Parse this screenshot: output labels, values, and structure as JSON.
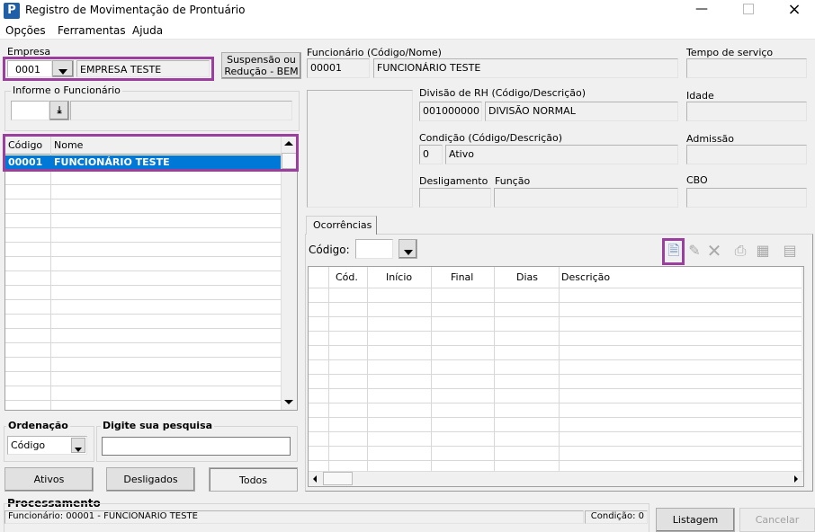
{
  "window": {
    "title": "Registro de Movimentação de Prontuário",
    "app_icon": "P"
  },
  "menu": [
    "Opções",
    "Ferramentas",
    "Ajuda"
  ],
  "empresa": {
    "label": "Empresa",
    "code": "0001",
    "name": "EMPRESA TESTE"
  },
  "suspensao_button": {
    "line1": "Suspensão ou",
    "line2": "Redução - BEM"
  },
  "informe": {
    "label": "Informe o Funcionário",
    "value": "",
    "name": ""
  },
  "employee_grid": {
    "columns": [
      "Código",
      "Nome"
    ],
    "rows": [
      {
        "codigo": "00001",
        "nome": "FUNCIONÁRIO TESTE"
      }
    ]
  },
  "ordenacao": {
    "label": "Ordenação",
    "value": "Código"
  },
  "pesquisa": {
    "label": "Digite sua pesquisa",
    "value": ""
  },
  "filter_buttons": [
    "Ativos",
    "Desligados",
    "Todos"
  ],
  "details": {
    "funcionario_label": "Funcionário (Código/Nome)",
    "funcionario_code": "00001",
    "funcionario_name": "FUNCIONÁRIO TESTE",
    "tempo_label": "Tempo de serviço",
    "tempo": "",
    "divisao_label": "Divisão de RH (Código/Descrição)",
    "divisao_code": "001000000",
    "divisao_desc": "DIVISÃO NORMAL",
    "idade_label": "Idade",
    "idade": "",
    "condicao_label": "Condição (Código/Descrição)",
    "condicao_code": "0",
    "condicao_desc": "Ativo",
    "admissao_label": "Admissão",
    "admissao": "",
    "desligamento_label": "Desligamento",
    "desligamento": "",
    "funcao_label": "Função",
    "funcao": "",
    "cbo_label": "CBO",
    "cbo": ""
  },
  "ocorrencias": {
    "tab": "Ocorrências",
    "codigo_label": "Código:",
    "codigo": "",
    "columns": [
      "",
      "Cód.",
      "Início",
      "Final",
      "Dias",
      "Descrição"
    ]
  },
  "processamento": {
    "label": "Processamento",
    "status": "Funcionário: 00001 - FUNCIONÁRIO TESTE",
    "condicao": "Condição: 0"
  },
  "actions": {
    "listagem": "Listagem",
    "cancelar": "Cancelar"
  },
  "colors": {
    "highlight": "#9a3f9e",
    "selection": "#0078d7"
  }
}
